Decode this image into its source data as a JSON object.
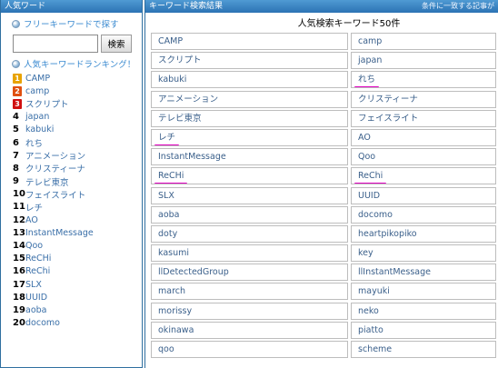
{
  "left_panel": {
    "header": "人気ワード",
    "free_search_label": "フリーキーワードで探す",
    "search_value": "",
    "search_button": "検索",
    "ranking_label": "人気キーワードランキング！",
    "ranking": [
      {
        "rank": "1",
        "text": "CAMP"
      },
      {
        "rank": "2",
        "text": "camp"
      },
      {
        "rank": "3",
        "text": "スクリプト"
      },
      {
        "rank": "4",
        "text": "japan"
      },
      {
        "rank": "5",
        "text": "kabuki"
      },
      {
        "rank": "6",
        "text": "れち"
      },
      {
        "rank": "7",
        "text": "アニメーション"
      },
      {
        "rank": "8",
        "text": "クリスティーナ"
      },
      {
        "rank": "9",
        "text": "テレビ東京"
      },
      {
        "rank": "10",
        "text": "フェイスライト"
      },
      {
        "rank": "11",
        "text": "レチ"
      },
      {
        "rank": "12",
        "text": "AO"
      },
      {
        "rank": "13",
        "text": "InstantMessage"
      },
      {
        "rank": "14",
        "text": "Qoo"
      },
      {
        "rank": "15",
        "text": "ReCHi"
      },
      {
        "rank": "16",
        "text": "ReChi"
      },
      {
        "rank": "17",
        "text": "SLX"
      },
      {
        "rank": "18",
        "text": "UUID"
      },
      {
        "rank": "19",
        "text": "aoba"
      },
      {
        "rank": "20",
        "text": "docomo"
      }
    ],
    "badge_colors": [
      "#e8a300",
      "#e05010",
      "#d01010"
    ]
  },
  "right_panel": {
    "header": "キーワード検索結果",
    "header_sub": "条件に一致する記事が",
    "table_title": "人気検索キーワード50件",
    "highlight_color": "#e000c0",
    "rows": [
      [
        "CAMP",
        "camp"
      ],
      [
        "スクリプト",
        "japan"
      ],
      [
        "kabuki",
        "れち"
      ],
      [
        "アニメーション",
        "クリスティーナ"
      ],
      [
        "テレビ東京",
        "フェイスライト"
      ],
      [
        "レチ",
        "AO"
      ],
      [
        "InstantMessage",
        "Qoo"
      ],
      [
        "ReCHi",
        "ReChi"
      ],
      [
        "SLX",
        "UUID"
      ],
      [
        "aoba",
        "docomo"
      ],
      [
        "doty",
        "heartpikopiko"
      ],
      [
        "kasumi",
        "key"
      ],
      [
        "llDetectedGroup",
        "llInstantMessage"
      ],
      [
        "march",
        "mayuki"
      ],
      [
        "morissy",
        "neko"
      ],
      [
        "okinawa",
        "piatto"
      ],
      [
        "qoo",
        "scheme"
      ]
    ],
    "underlined": [
      "2-1",
      "5-0",
      "7-0",
      "7-1"
    ]
  }
}
